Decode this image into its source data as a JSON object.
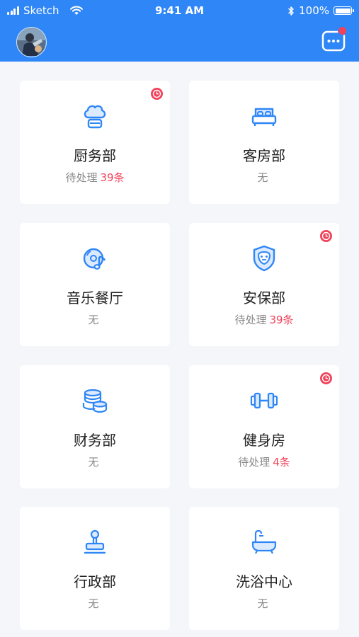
{
  "status_bar": {
    "carrier": "Sketch",
    "time": "9:41 AM",
    "battery": "100%"
  },
  "header": {
    "avatar_icon": "user-avatar",
    "message_icon": "message-icon"
  },
  "colors": {
    "primary": "#2f86f6",
    "alert": "#f0425a",
    "icon_blue": "#2f86f6"
  },
  "departments": [
    {
      "name": "厨务部",
      "status": "待处理",
      "count": "39条",
      "icon": "chef-hat-icon",
      "alert": true
    },
    {
      "name": "客房部",
      "status": "无",
      "count": "",
      "icon": "bed-icon",
      "alert": false
    },
    {
      "name": "音乐餐厅",
      "status": "无",
      "count": "",
      "icon": "music-record-icon",
      "alert": false
    },
    {
      "name": "安保部",
      "status": "待处理",
      "count": "39条",
      "icon": "shield-icon",
      "alert": true
    },
    {
      "name": "财务部",
      "status": "无",
      "count": "",
      "icon": "coins-icon",
      "alert": false
    },
    {
      "name": "健身房",
      "status": "待处理",
      "count": "4条",
      "icon": "dumbbell-icon",
      "alert": true
    },
    {
      "name": "行政部",
      "status": "无",
      "count": "",
      "icon": "stamp-icon",
      "alert": false
    },
    {
      "name": "洗浴中心",
      "status": "无",
      "count": "",
      "icon": "bathtub-icon",
      "alert": false
    }
  ]
}
